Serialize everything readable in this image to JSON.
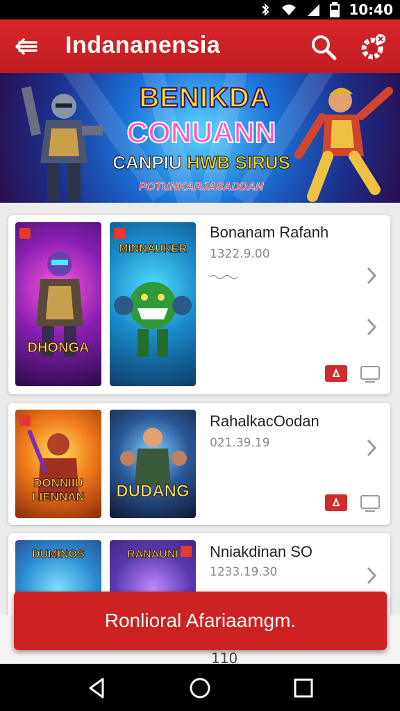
{
  "status_bar": {
    "time": "10:40",
    "icons": [
      "bluetooth-icon",
      "wifi-icon",
      "signal-icon",
      "battery-icon"
    ]
  },
  "app_bar": {
    "title": "Indananensia",
    "back_icon": "back-arrow-icon",
    "search_icon": "search-icon",
    "settings_icon": "gear-icon",
    "color": "#d12328"
  },
  "banner": {
    "line1": "BENIKDA",
    "line2": "CONUANN",
    "line3_a": "CANPIU",
    "line3_b": "HWB",
    "line3_c": "SIRUS",
    "line4": "POTUNKARJASADDAN"
  },
  "cards": [
    {
      "name": "Bonanam Rafanh",
      "number": "1322.9.00",
      "thumb1_caption": "DHONGA",
      "thumb2_caption": "MINNAUKER"
    },
    {
      "name": "RahalkacOodan",
      "number": "021.39.19",
      "thumb1_caption": "DONNIIU LIENNAN",
      "thumb2_caption": "DUDANG"
    },
    {
      "name": "Nniakdinan SO",
      "number": "1233.19.30",
      "thumb1_caption": "DUMINOS",
      "thumb2_caption": "RANAUNI"
    }
  ],
  "toast": {
    "message": "Ronliorаl Afariaamgm."
  },
  "peek": {
    "text": "110"
  },
  "nav_bar": {
    "icons": [
      "nav-back-icon",
      "nav-home-icon",
      "nav-recents-icon"
    ]
  }
}
